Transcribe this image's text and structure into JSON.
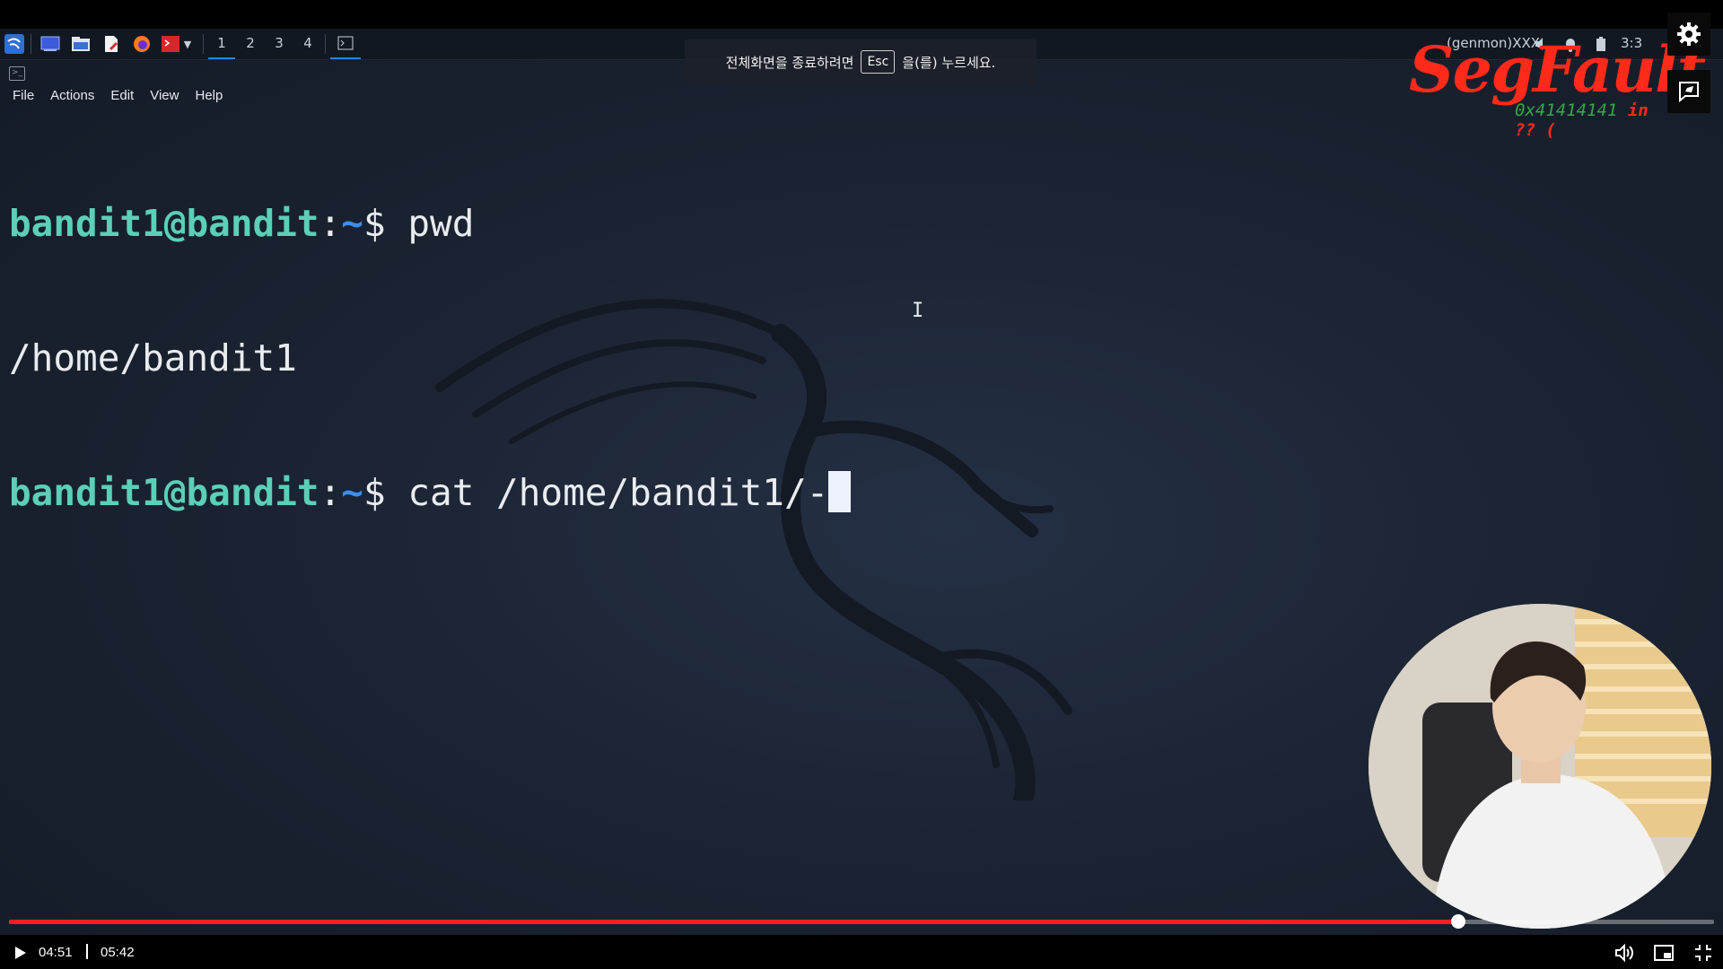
{
  "panel": {
    "workspaces": [
      "1",
      "2",
      "3",
      "4"
    ],
    "genmon": "(genmon)XXX",
    "clock": "3:3"
  },
  "notice": {
    "before": "전체화면을 종료하려면",
    "key": "Esc",
    "after": "을(를) 누르세요."
  },
  "terminal": {
    "menu": [
      "File",
      "Actions",
      "Edit",
      "View",
      "Help"
    ],
    "lines": [
      {
        "user": "bandit1@bandit",
        "colon": ":",
        "path": "~",
        "dollar": "$",
        "cmd": " pwd"
      },
      {
        "output": "/home/bandit1"
      },
      {
        "user": "bandit1@bandit",
        "colon": ":",
        "path": "~",
        "dollar": "$",
        "cmd": " cat /home/bandit1/-"
      }
    ]
  },
  "logo": {
    "main": "SegFault",
    "sub": "0x41414141",
    "sub2": " in ?? ("
  },
  "player": {
    "current_time": "04:51",
    "total_time": "05:42",
    "progress": 0.85,
    "accent": "#ff1e1e"
  },
  "icons": {
    "settings": "gear-icon",
    "feedback": "feedback-icon",
    "play": "play-icon",
    "volume": "volume-icon",
    "miniplayer": "miniplayer-icon",
    "exit_fullscreen": "exit-fullscreen-icon"
  }
}
